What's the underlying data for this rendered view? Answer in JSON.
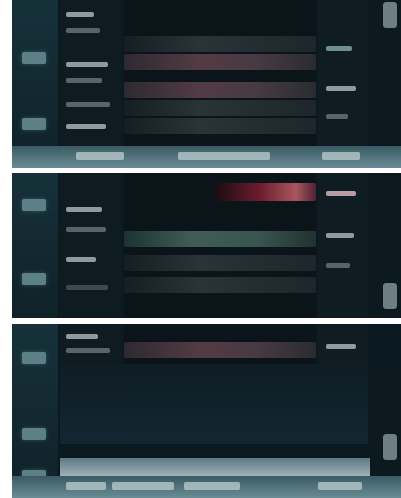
{
  "app": {
    "title": "",
    "panels": [
      {
        "label": ""
      },
      {
        "label": ""
      },
      {
        "label": ""
      }
    ]
  },
  "colors": {
    "background": "#0b1a20",
    "selection": "#533b45",
    "highlight": "#405c55",
    "warning": "#aa5660",
    "footer": "#6a8d95"
  },
  "icons": [
    "sidebar-button",
    "scrollbar-thumb",
    "row-selection"
  ]
}
